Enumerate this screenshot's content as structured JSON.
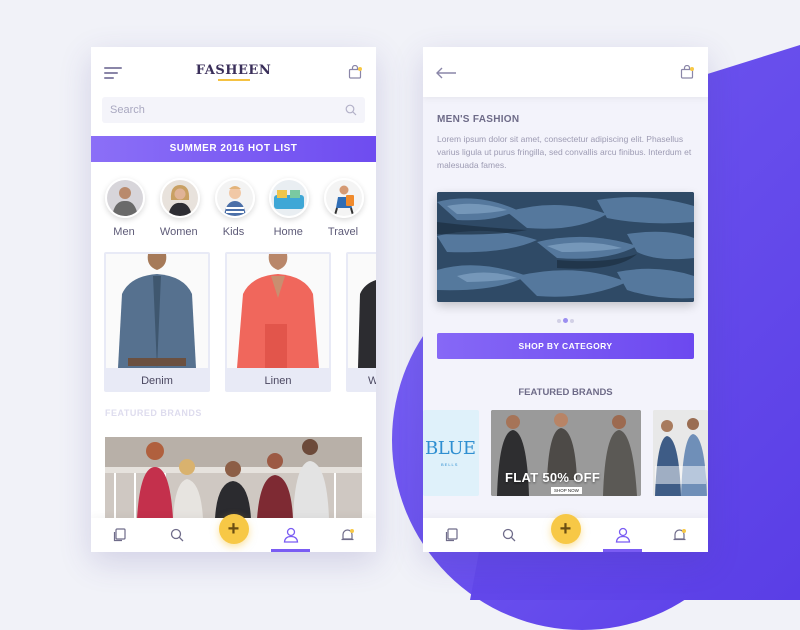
{
  "left": {
    "logo": "FASHEEN",
    "search_placeholder": "Search",
    "banner": "SUMMER 2016 HOT LIST",
    "categories": [
      {
        "label": "Men"
      },
      {
        "label": "Women"
      },
      {
        "label": "Kids"
      },
      {
        "label": "Home"
      },
      {
        "label": "Travel"
      }
    ],
    "products": [
      {
        "label": "Denim"
      },
      {
        "label": "Linen"
      },
      {
        "label": "W"
      }
    ],
    "featured_faded": "FEATURED BRANDS"
  },
  "right": {
    "section_title": "MEN'S FASHION",
    "description": "Lorem ipsum dolor sit amet, consectetur adipiscing elit. Phasellus varius ligula ut purus fringilla, sed convallis arcu finibus. Interdum et malesuada fames.",
    "shop_button": "SHOP BY CATEGORY",
    "featured_title": "FEATURED BRANDS",
    "brand1_text": "BLUE",
    "brand1_sub": "BELLS",
    "brand2_text": "FLAT 50% OFF",
    "brand2_button": "SHOP NOW"
  },
  "tabbar": {
    "fab_label": "+",
    "icons": [
      "pages-icon",
      "search-icon",
      "add-icon",
      "profile-icon",
      "notification-icon"
    ]
  },
  "colors": {
    "accent": "#7a5cf3",
    "fab": "#f7c846",
    "background": "#f1f2f8"
  }
}
